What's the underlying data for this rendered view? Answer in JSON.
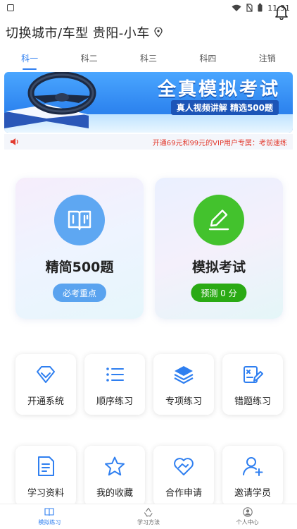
{
  "status_bar": {
    "time": "11:31"
  },
  "header": {
    "title": "切换城市/车型 贵阳-小车"
  },
  "tabs": [
    "科一",
    "科二",
    "科三",
    "科四",
    "注销"
  ],
  "banner": {
    "title": "全真模拟考试",
    "subtitle": "真人视频讲解 精选500题"
  },
  "notice": {
    "text": "开通69元和99元的VIP用户专属：考前速练"
  },
  "cards": [
    {
      "title": "精简500题",
      "badge": "必考重点"
    },
    {
      "title": "模拟考试",
      "badge": "预测 0 分"
    }
  ],
  "grid": [
    {
      "label": "开通系统",
      "icon": "diamond-icon"
    },
    {
      "label": "顺序练习",
      "icon": "list-icon"
    },
    {
      "label": "专项练习",
      "icon": "layers-icon"
    },
    {
      "label": "错题练习",
      "icon": "wrong-answers-icon"
    },
    {
      "label": "学习资料",
      "icon": "document-icon"
    },
    {
      "label": "我的收藏",
      "icon": "star-icon"
    },
    {
      "label": "合作申请",
      "icon": "handshake-icon"
    },
    {
      "label": "邀请学员",
      "icon": "add-user-icon"
    }
  ],
  "bottom_nav": [
    "模拟练习",
    "学习方法",
    "个人中心"
  ],
  "colors": {
    "accent": "#2f7ff0",
    "green": "#43c22d",
    "notice_red": "#e23b2f"
  }
}
